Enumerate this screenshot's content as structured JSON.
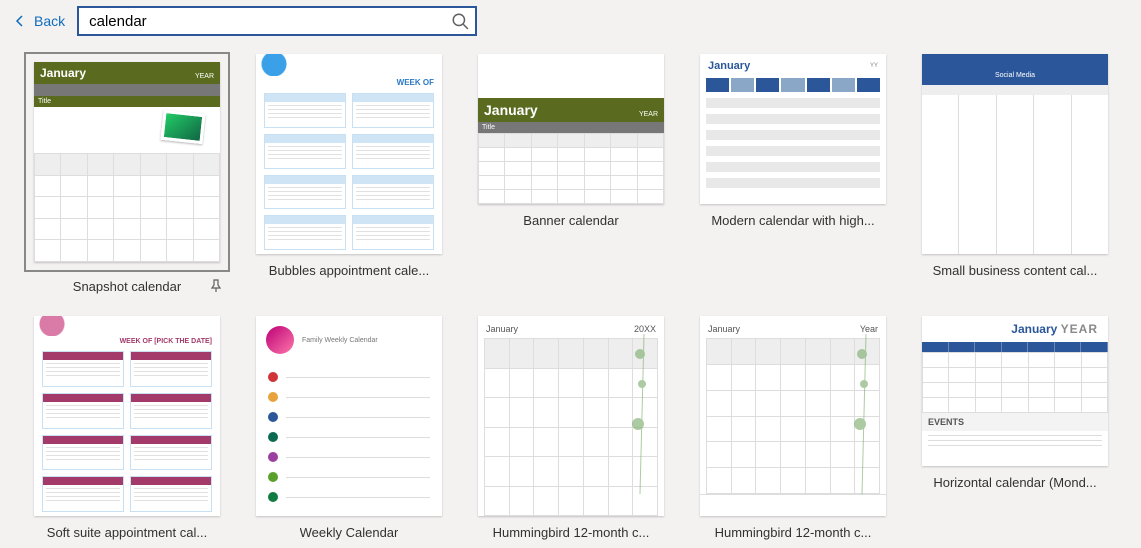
{
  "header": {
    "back_label": "Back",
    "search_value": "calendar"
  },
  "templates": [
    {
      "label": "Snapshot calendar",
      "selected": true,
      "pinned": true
    },
    {
      "label": "Bubbles appointment cale..."
    },
    {
      "label": "Banner calendar"
    },
    {
      "label": "Modern calendar with high..."
    },
    {
      "label": "Small business content cal..."
    },
    {
      "label": "Soft suite appointment cal..."
    },
    {
      "label": "Weekly Calendar"
    },
    {
      "label": "Hummingbird 12-month c..."
    },
    {
      "label": "Hummingbird 12-month c..."
    },
    {
      "label": "Horizontal calendar (Mond..."
    }
  ],
  "thumb": {
    "jan": "January",
    "year": "YEAR",
    "title": "Title",
    "week_of": "WEEK OF",
    "pink_week": "WEEK OF [PICK THE DATE]",
    "year_sm": "Year",
    "year_xx": "20XX",
    "yy": "YY",
    "social": "Social Media",
    "weekly": "Family Weekly Calendar",
    "events": "EVENTS"
  }
}
